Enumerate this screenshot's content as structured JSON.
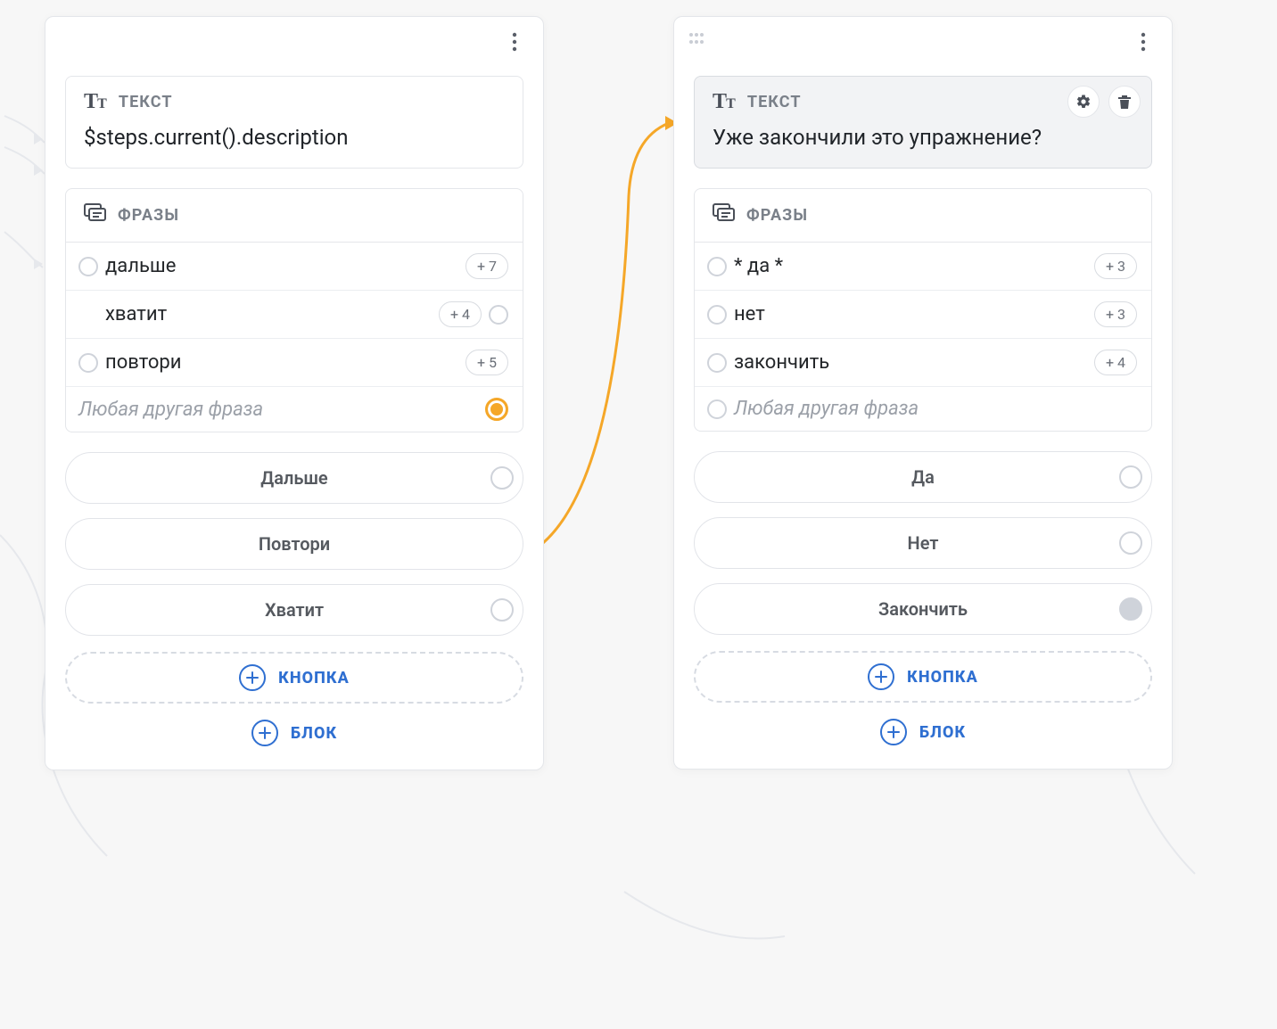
{
  "labels": {
    "text_header": "ТЕКСТ",
    "phrases_header": "ФРАЗЫ",
    "add_button": "КНОПКА",
    "add_block": "БЛОК"
  },
  "colors": {
    "accent_blue": "#2f6fd1",
    "accent_orange": "#f5a728",
    "border": "#e4e6ea",
    "text_muted": "#7a8089"
  },
  "cards": [
    {
      "id": "left",
      "selected": false,
      "text_block": {
        "content": "$steps.current().description",
        "selected": false
      },
      "phrases": [
        {
          "label": "дальше",
          "count": "+ 7",
          "has_in_port": true,
          "out_port": "none"
        },
        {
          "label": "хватит",
          "count": "+ 4",
          "has_in_port": false,
          "out_port": "normal"
        },
        {
          "label": "повтори",
          "count": "+ 5",
          "has_in_port": true,
          "out_port": "none"
        }
      ],
      "phrase_placeholder": "Любая другая фраза",
      "placeholder_out_active": true,
      "buttons": [
        {
          "label": "Дальше",
          "out_port": "normal"
        },
        {
          "label": "Повтори",
          "out_port": "none"
        },
        {
          "label": "Хватит",
          "out_port": "normal"
        }
      ]
    },
    {
      "id": "right",
      "selected": true,
      "text_block": {
        "content": "Уже закончили это упражнение?",
        "selected": true
      },
      "phrases": [
        {
          "label": "* да *",
          "count": "+ 3",
          "has_in_port": true,
          "out_port": "none"
        },
        {
          "label": "нет",
          "count": "+ 3",
          "has_in_port": true,
          "out_port": "none"
        },
        {
          "label": "закончить",
          "count": "+ 4",
          "has_in_port": true,
          "out_port": "none"
        }
      ],
      "phrase_placeholder": "Любая другая фраза",
      "placeholder_out_active": false,
      "buttons": [
        {
          "label": "Да",
          "out_port": "normal"
        },
        {
          "label": "Нет",
          "out_port": "normal"
        },
        {
          "label": "Закончить",
          "out_port": "filled"
        }
      ]
    }
  ]
}
